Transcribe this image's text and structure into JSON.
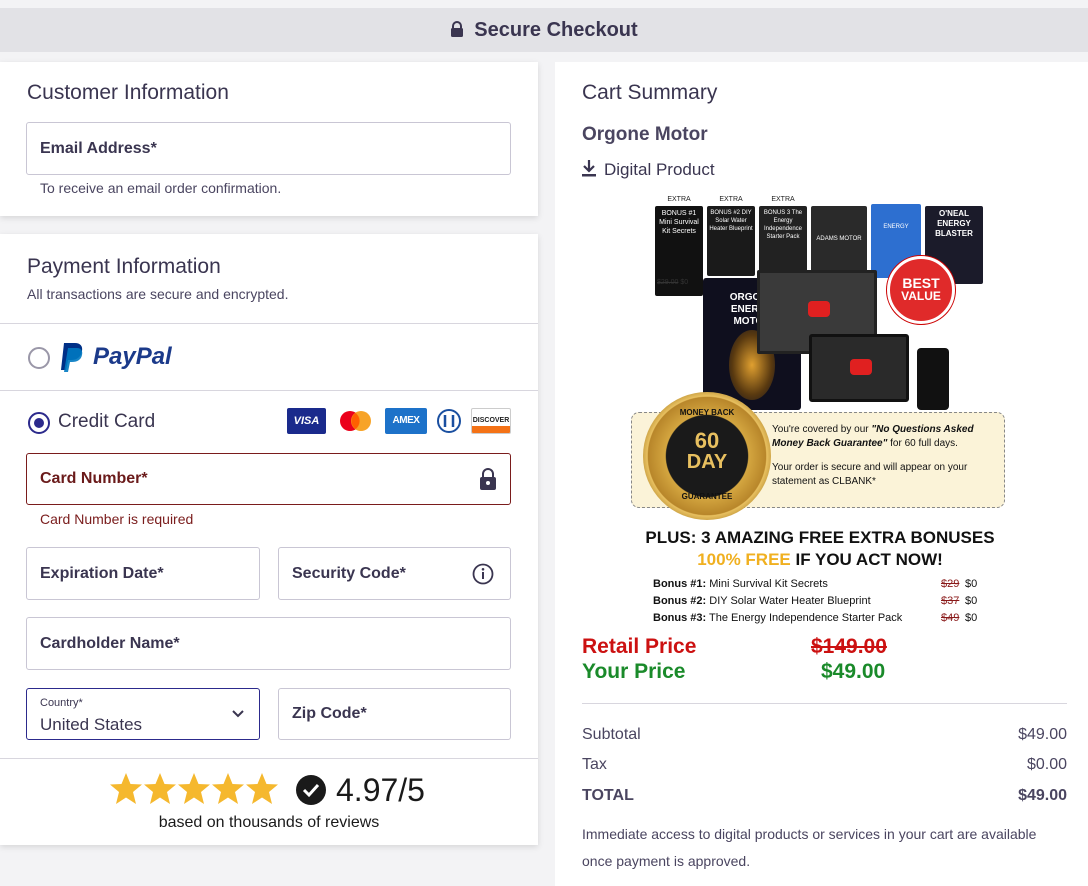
{
  "header": {
    "title": "Secure Checkout"
  },
  "customer": {
    "heading": "Customer Information",
    "email_label": "Email Address*",
    "email_helper": "To receive an email order confirmation."
  },
  "payment": {
    "heading": "Payment Information",
    "subtitle": "All transactions are secure and encrypted.",
    "paypal_label": "PayPal",
    "credit_label": "Credit Card",
    "selected_method": "credit_card",
    "card_brands": [
      "VISA",
      "Mastercard",
      "AMEX",
      "Diners Club",
      "DISCOVER"
    ],
    "card_number_label": "Card Number*",
    "card_number_error": "Card Number is required",
    "expiration_label": "Expiration Date*",
    "security_label": "Security Code*",
    "cardholder_label": "Cardholder Name*",
    "country_small_label": "Country*",
    "country_value": "United States",
    "zip_label": "Zip Code*",
    "rating_value": "4.97/5",
    "rating_caption": "based on thousands of reviews",
    "rating_stars": 5
  },
  "cart": {
    "heading": "Cart Summary",
    "product_name": "Orgone Motor",
    "product_type": "Digital Product",
    "promo": {
      "books": [
        {
          "badge": "EXTRA",
          "title": "BONUS #1 Mini Survival Kit Secrets"
        },
        {
          "badge": "EXTRA",
          "title": "BONUS #2 DIY Solar Water Heater Blueprint"
        },
        {
          "badge": "EXTRA",
          "title": "BONUS 3 The Energy Independence Starter Pack"
        },
        {
          "badge": "",
          "title": "ADAMS MOTOR"
        },
        {
          "badge": "",
          "title": "ENERGY"
        },
        {
          "badge": "",
          "title": "O'NEAL ENERGY BLASTER"
        }
      ],
      "small_price_old": "$29.00",
      "small_price_new": "$0",
      "main_box_title": "ORGONE ENERGY MOTOR",
      "best_value": [
        "BEST",
        "VALUE"
      ],
      "seal_top": "MONEY BACK",
      "seal_days": "60",
      "seal_unit": "DAY",
      "seal_bottom": "GUARANTEE",
      "guarantee_line1_pre": "You're covered by our ",
      "guarantee_line1_em": "\"No Questions Asked Money Back Guarantee\"",
      "guarantee_line1_post": " for 60 full days.",
      "guarantee_line2": "Your order is secure and will appear on your statement as CLBANK*",
      "plus_line": "PLUS: 3 AMAZING FREE EXTRA BONUSES",
      "free_line_a": "100% FREE",
      "free_line_b": " IF YOU ACT NOW!",
      "bonuses": [
        {
          "label": "Bonus #1:",
          "name": "Mini Survival Kit Secrets",
          "old": "$29",
          "new": "$0"
        },
        {
          "label": "Bonus #2:",
          "name": "DIY Solar Water Heater Blueprint",
          "old": "$37",
          "new": "$0"
        },
        {
          "label": "Bonus #3:",
          "name": "The Energy Independence Starter Pack",
          "old": "$49",
          "new": "$0"
        }
      ],
      "retail_label": "Retail Price",
      "retail_value": "$149.00",
      "your_label": "Your Price",
      "your_value": "$49.00"
    },
    "subtotal_label": "Subtotal",
    "subtotal_value": "$49.00",
    "tax_label": "Tax",
    "tax_value": "$0.00",
    "total_label": "TOTAL",
    "total_value": "$49.00",
    "footnote": "Immediate access to digital products or services in your cart are available once payment is approved.",
    "colors": {
      "retail_red": "#cc1111",
      "price_green": "#1a8a2a",
      "accent": "#2c2a8c"
    }
  }
}
